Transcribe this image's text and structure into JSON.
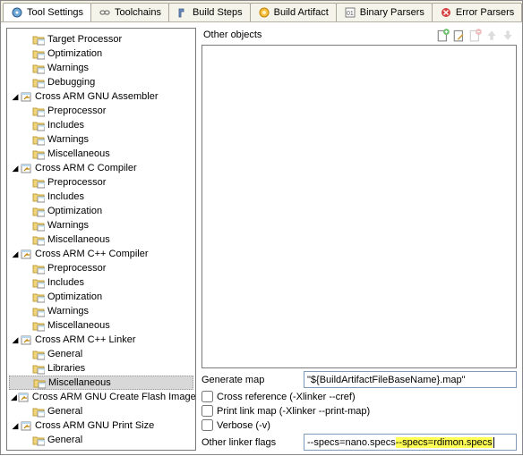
{
  "tabs": [
    {
      "label": "Tool Settings"
    },
    {
      "label": "Toolchains"
    },
    {
      "label": "Build Steps"
    },
    {
      "label": "Build Artifact"
    },
    {
      "label": "Binary Parsers"
    },
    {
      "label": "Error Parsers"
    }
  ],
  "tree": {
    "top": [
      {
        "label": "Target Processor"
      },
      {
        "label": "Optimization"
      },
      {
        "label": "Warnings"
      },
      {
        "label": "Debugging"
      }
    ],
    "groups": [
      {
        "label": "Cross ARM GNU Assembler",
        "children": [
          "Preprocessor",
          "Includes",
          "Warnings",
          "Miscellaneous"
        ]
      },
      {
        "label": "Cross ARM C Compiler",
        "children": [
          "Preprocessor",
          "Includes",
          "Optimization",
          "Warnings",
          "Miscellaneous"
        ]
      },
      {
        "label": "Cross ARM C++ Compiler",
        "children": [
          "Preprocessor",
          "Includes",
          "Optimization",
          "Warnings",
          "Miscellaneous"
        ]
      },
      {
        "label": "Cross ARM C++ Linker",
        "children": [
          "General",
          "Libraries",
          "Miscellaneous"
        ],
        "selected": 2
      },
      {
        "label": "Cross ARM GNU Create Flash Image",
        "children": [
          "General"
        ]
      },
      {
        "label": "Cross ARM GNU Print Size",
        "children": [
          "General"
        ]
      }
    ]
  },
  "list": {
    "title": "Other objects"
  },
  "generate_map": {
    "label": "Generate map",
    "value": "\"${BuildArtifactFileBaseName}.map\""
  },
  "checks": {
    "cross_ref": "Cross reference (-Xlinker --cref)",
    "print_map": "Print link map (-Xlinker --print-map)",
    "verbose": "Verbose (-v)"
  },
  "other_flags": {
    "label": "Other linker flags",
    "prefix": "--specs=nano.specs ",
    "highlight": "--specs=rdimon.specs"
  }
}
